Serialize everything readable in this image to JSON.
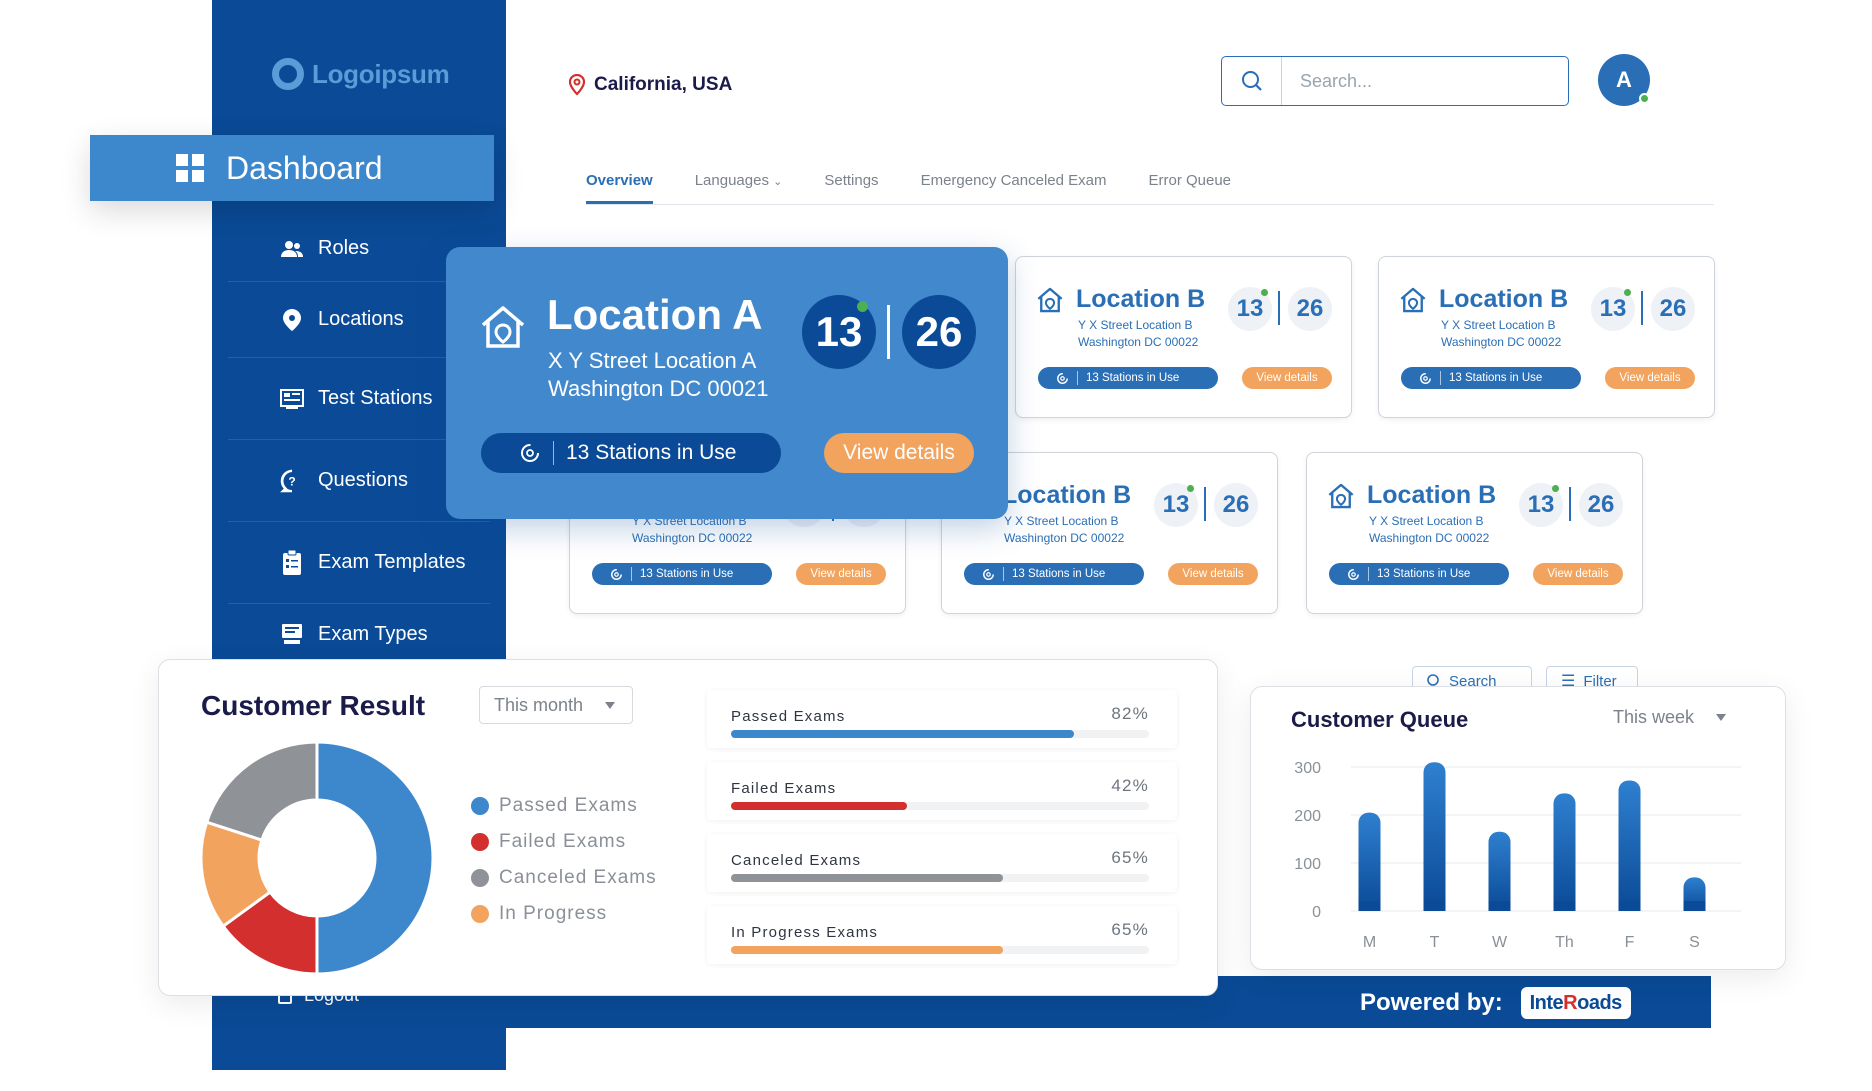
{
  "brand": {
    "logo_text": "Logoipsum"
  },
  "sidebar": {
    "active": {
      "label": "Dashboard",
      "icon": "grid-icon"
    },
    "items": [
      {
        "label": "Roles",
        "icon": "users-icon"
      },
      {
        "label": "Locations",
        "icon": "map-pin-icon"
      },
      {
        "label": "Test Stations",
        "icon": "stations-icon"
      },
      {
        "label": "Questions",
        "icon": "question-icon"
      },
      {
        "label": "Exam Templates",
        "icon": "clipboard-icon"
      },
      {
        "label": "Exam Types",
        "icon": "exam-types-icon"
      }
    ],
    "logout_label": "Logout"
  },
  "header": {
    "location": "California, USA",
    "search_placeholder": "Search...",
    "avatar_initial": "A"
  },
  "tabs": [
    {
      "label": "Overview",
      "active": true
    },
    {
      "label": "Languages",
      "dropdown": true
    },
    {
      "label": "Settings"
    },
    {
      "label": "Emergency Canceled Exam"
    },
    {
      "label": "Error Queue"
    }
  ],
  "featured_card": {
    "title": "Location A",
    "address_line1": "X Y Street Location A",
    "address_line2": "Washington DC 00021",
    "count_a": "13",
    "count_b": "26",
    "stations_label": "13 Stations in Use",
    "view_label": "View details"
  },
  "cards": [
    {
      "title": "Location B",
      "address_line1": "Y X Street Location B",
      "address_line2": "Washington DC 00022",
      "count_a": "13",
      "count_b": "26",
      "stations_label": "13 Stations in Use",
      "view_label": "View details"
    },
    {
      "title": "Location B",
      "address_line1": "Y X Street Location B",
      "address_line2": "Washington DC 00022",
      "count_a": "13",
      "count_b": "26",
      "stations_label": "13 Stations in Use",
      "view_label": "View details"
    },
    {
      "title": "Location B",
      "address_line1": "Y X Street Location B",
      "address_line2": "Washington DC 00022",
      "count_a": "13",
      "count_b": "26",
      "stations_label": "13 Stations in Use",
      "view_label": "View details"
    },
    {
      "title": "Location B",
      "address_line1": "Y X Street Location B",
      "address_line2": "Washington DC 00022",
      "count_a": "13",
      "count_b": "26",
      "stations_label": "13 Stations in Use",
      "view_label": "View details"
    },
    {
      "title": "Location B",
      "address_line1": "Y X Street Location B",
      "address_line2": "Washington DC 00022",
      "count_a": "13",
      "count_b": "26",
      "stations_label": "13 Stations in Use",
      "view_label": "View details"
    }
  ],
  "table_tools": {
    "search_label": "Search",
    "filter_label": "Filter"
  },
  "customer_result": {
    "title": "Customer Result",
    "period": "This month",
    "legend": [
      {
        "label": "Passed Exams",
        "color": "#3d87cc"
      },
      {
        "label": "Failed Exams",
        "color": "#d32f2f"
      },
      {
        "label": "Canceled Exams",
        "color": "#8f9296"
      },
      {
        "label": "In Progress",
        "color": "#f2a35e"
      }
    ],
    "progress": [
      {
        "label": "Passed Exams",
        "percent_text": "82%",
        "value": 82,
        "color": "#3d87cc"
      },
      {
        "label": "Failed Exams",
        "percent_text": "42%",
        "value": 42,
        "color": "#d32f2f"
      },
      {
        "label": "Canceled Exams",
        "percent_text": "65%",
        "value": 65,
        "color": "#8f9296"
      },
      {
        "label": "In Progress Exams",
        "percent_text": "65%",
        "value": 65,
        "color": "#f2a35e"
      }
    ]
  },
  "customer_queue": {
    "title": "Customer Queue",
    "period": "This week"
  },
  "footer": {
    "powered_label": "Powered by:",
    "partner_logo_a": "Inte",
    "partner_logo_b": "R",
    "partner_logo_c": "oads"
  },
  "chart_data": [
    {
      "type": "pie",
      "title": "Customer Result",
      "categories": [
        "Passed Exams",
        "Failed Exams",
        "In Progress",
        "Canceled Exams"
      ],
      "values": [
        50,
        15,
        15,
        20
      ],
      "colors": [
        "#3d87cc",
        "#d32f2f",
        "#f2a35e",
        "#8f9296"
      ],
      "donut": true
    },
    {
      "type": "bar",
      "title": "Customer Queue",
      "categories": [
        "M",
        "T",
        "W",
        "Th",
        "F",
        "S"
      ],
      "values": [
        205,
        310,
        165,
        245,
        272,
        70
      ],
      "ylim": [
        0,
        300
      ],
      "yticks": [
        0,
        100,
        200,
        300
      ],
      "grid": true,
      "xlabel": "",
      "ylabel": ""
    }
  ]
}
